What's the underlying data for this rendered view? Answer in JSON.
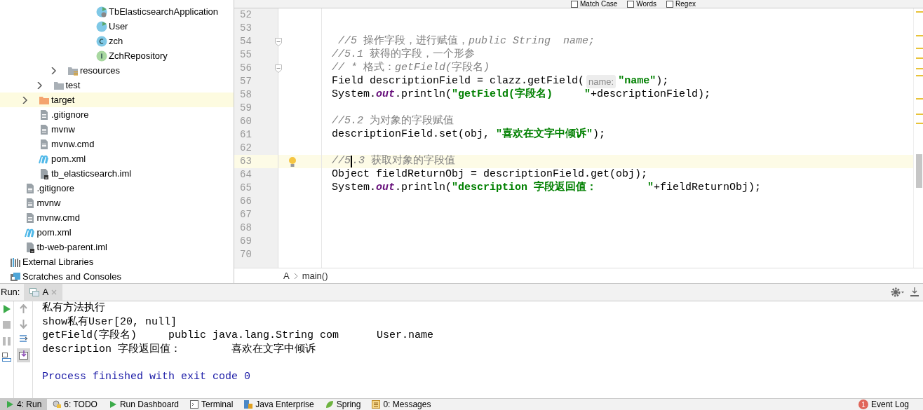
{
  "project_tree": [
    {
      "children": [
        {
          "children": [
            {
              "children": [
                {
                  "children": [
                    {
                      "children": [
                        {
                          "children": [
                            {
                              "label": "TbElasticsearchApplication",
                              "kind": "app-class",
                              "selected": false
                            },
                            {
                              "label": "User",
                              "kind": "run-class",
                              "selected": false
                            },
                            {
                              "label": "zch",
                              "kind": "class",
                              "selected": false
                            },
                            {
                              "label": "ZchRepository",
                              "kind": "interface",
                              "selected": false
                            }
                          ]
                        }
                      ]
                    },
                    {
                      "label": "resources",
                      "kind": "resources-folder",
                      "expanded": false,
                      "selected": false
                    }
                  ]
                },
                {
                  "label": "test",
                  "kind": "folder",
                  "expanded": false,
                  "selected": false
                }
              ]
            },
            {
              "label": "target",
              "kind": "target-folder",
              "expanded": false,
              "selected": true
            },
            {
              "label": ".gitignore",
              "kind": "file",
              "selected": false
            },
            {
              "label": "mvnw",
              "kind": "file",
              "selected": false
            },
            {
              "label": "mvnw.cmd",
              "kind": "file",
              "selected": false
            },
            {
              "label": "pom.xml",
              "kind": "maven",
              "selected": false
            },
            {
              "label": "tb_elasticsearch.iml",
              "kind": "module-file",
              "selected": false
            }
          ]
        },
        {
          "label": ".gitignore",
          "kind": "file",
          "selected": false
        },
        {
          "label": "mvnw",
          "kind": "file",
          "selected": false
        },
        {
          "label": "mvnw.cmd",
          "kind": "file",
          "selected": false
        },
        {
          "label": "pom.xml",
          "kind": "maven",
          "selected": false
        },
        {
          "label": "tb-web-parent.iml",
          "kind": "module-file",
          "selected": false
        }
      ]
    },
    {
      "label": "External Libraries",
      "kind": "libraries",
      "selected": false
    },
    {
      "label": "Scratches and Consoles",
      "kind": "scratches",
      "selected": false
    }
  ],
  "find_bar": {
    "options": [
      {
        "label": "Match Case",
        "checked": false
      },
      {
        "label": "Words",
        "checked": false
      },
      {
        "label": "Regex",
        "checked": false
      }
    ]
  },
  "editor": {
    "lines": [
      {
        "number": "52"
      },
      {
        "number": "53"
      },
      {
        "number": "54",
        "fold": true,
        "tokens": [
          {
            "text": " //5 ",
            "kind": "comment"
          },
          {
            "text": "操作字段，进行赋值，",
            "kind": "comment-cjk"
          },
          {
            "text": "public String  name;",
            "kind": "comment"
          }
        ]
      },
      {
        "number": "55",
        "tokens": [
          {
            "text": "//5.1 ",
            "kind": "comment"
          },
          {
            "text": "获得的字段，一个形参",
            "kind": "comment-cjk"
          }
        ]
      },
      {
        "number": "56",
        "fold": true,
        "tokens": [
          {
            "text": "// * ",
            "kind": "comment"
          },
          {
            "text": "格式：",
            "kind": "comment-cjk"
          },
          {
            "text": "getField(",
            "kind": "comment"
          },
          {
            "text": "字段名",
            "kind": "comment-cjk"
          },
          {
            "text": ")",
            "kind": "comment"
          }
        ]
      },
      {
        "number": "57",
        "tokens": [
          {
            "text": "Field descriptionField = clazz.getField(",
            "kind": "plain"
          },
          {
            "text": "name:",
            "kind": "hint"
          },
          {
            "text": "\"name\"",
            "kind": "string"
          },
          {
            "text": ");",
            "kind": "plain"
          }
        ]
      },
      {
        "number": "58",
        "tokens": [
          {
            "text": "System.",
            "kind": "plain"
          },
          {
            "text": "out",
            "kind": "static"
          },
          {
            "text": ".println(",
            "kind": "plain"
          },
          {
            "text": "\"getField(字段名)     \"",
            "kind": "string"
          },
          {
            "text": "+descriptionField);",
            "kind": "plain"
          }
        ]
      },
      {
        "number": "59"
      },
      {
        "number": "60",
        "tokens": [
          {
            "text": "//5.2 ",
            "kind": "comment"
          },
          {
            "text": "为对象的字段赋值",
            "kind": "comment-cjk"
          }
        ]
      },
      {
        "number": "61",
        "tokens": [
          {
            "text": "descriptionField.set(obj, ",
            "kind": "plain"
          },
          {
            "text": "\"喜欢在文字中倾诉\"",
            "kind": "string"
          },
          {
            "text": ");",
            "kind": "plain"
          }
        ]
      },
      {
        "number": "62"
      },
      {
        "number": "63",
        "current": true,
        "bulb": true,
        "tokens": [
          {
            "text": "//5",
            "kind": "comment"
          },
          {
            "kind": "caret"
          },
          {
            "text": ".3 ",
            "kind": "comment"
          },
          {
            "text": "获取对象的字段值",
            "kind": "comment-cjk"
          }
        ]
      },
      {
        "number": "64",
        "tokens": [
          {
            "text": "Object fieldReturnObj = descriptionField.get(obj);",
            "kind": "plain"
          }
        ]
      },
      {
        "number": "65",
        "tokens": [
          {
            "text": "System.",
            "kind": "plain"
          },
          {
            "text": "out",
            "kind": "static"
          },
          {
            "text": ".println(",
            "kind": "plain"
          },
          {
            "text": "\"description 字段返回值：        \"",
            "kind": "string"
          },
          {
            "text": "+fieldReturnObj);",
            "kind": "plain"
          }
        ]
      },
      {
        "number": "66"
      },
      {
        "number": "67"
      },
      {
        "number": "68"
      },
      {
        "number": "69"
      },
      {
        "number": "70"
      }
    ],
    "breadcrumbs": [
      "A",
      "main()"
    ]
  },
  "run_panel": {
    "label": "Run:",
    "tabs": [
      {
        "label": "A",
        "selected": true
      }
    ],
    "output": [
      {
        "text": "私有方法执行",
        "kind": "stdout"
      },
      {
        "text": "show私有User[20, null]",
        "kind": "stdout"
      },
      {
        "text": "getField(字段名)     public java.lang.String com      User.name",
        "kind": "stdout"
      },
      {
        "text": "description 字段返回值：        喜欢在文字中倾诉",
        "kind": "stdout"
      },
      {
        "kind": "blank"
      },
      {
        "text": "Process finished with exit code 0",
        "kind": "system"
      }
    ]
  },
  "tool_windows": [
    {
      "label": "4: Run",
      "kind": "run",
      "selected": true
    },
    {
      "label": "6: TODO",
      "kind": "todo",
      "selected": false
    },
    {
      "label": "Run Dashboard",
      "kind": "run",
      "selected": false
    },
    {
      "label": "Terminal",
      "kind": "terminal",
      "selected": false
    },
    {
      "label": "Java Enterprise",
      "kind": "enterprise",
      "selected": false
    },
    {
      "label": "Spring",
      "kind": "spring",
      "selected": false
    },
    {
      "label": "0: Messages",
      "kind": "messages",
      "selected": false
    }
  ],
  "event_log": {
    "label": "Event Log",
    "count": "1"
  }
}
